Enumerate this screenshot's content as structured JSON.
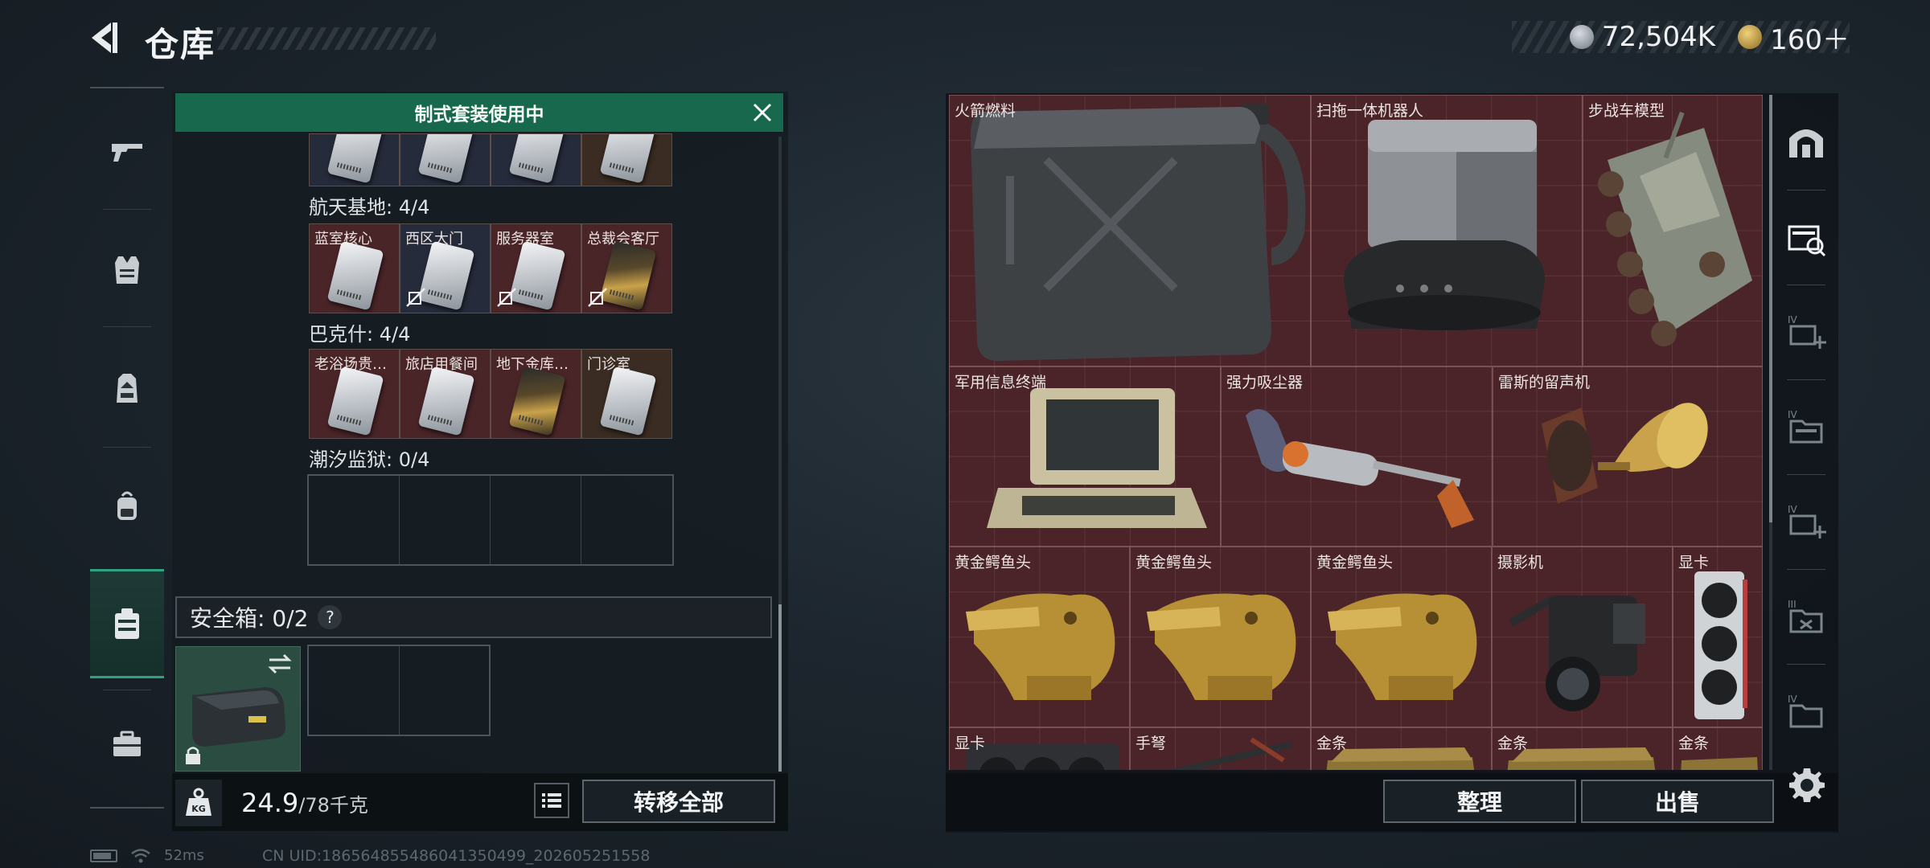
{
  "header": {
    "title": "仓库",
    "currency": [
      {
        "icon": "silver-coin-icon",
        "value": "72,504K"
      },
      {
        "icon": "gold-coin-icon",
        "value": "160＋"
      }
    ]
  },
  "left_rail": {
    "items": [
      {
        "name": "weapons",
        "icon": "gun-icon"
      },
      {
        "name": "armor",
        "icon": "armor-vest-icon"
      },
      {
        "name": "chest-rig",
        "icon": "chest-rig-icon"
      },
      {
        "name": "backpack",
        "icon": "backpack-icon"
      },
      {
        "name": "keycards",
        "icon": "keycard-case-icon",
        "active": true
      },
      {
        "name": "toolbox",
        "icon": "toolbox-icon"
      }
    ]
  },
  "suit": {
    "banner": "制式套装使用中"
  },
  "key_groups": [
    {
      "title": "航天基地: 4/4",
      "cards": [
        {
          "label": "蓝室核心",
          "style": "silver",
          "bg": "red",
          "unlinked": false
        },
        {
          "label": "西区大门",
          "style": "silver",
          "bg": "dark",
          "unlinked": true
        },
        {
          "label": "服务器室",
          "style": "silver",
          "bg": "red",
          "unlinked": true
        },
        {
          "label": "总裁会客厅",
          "style": "gold",
          "bg": "red",
          "unlinked": true
        }
      ]
    },
    {
      "title": "巴克什: 4/4",
      "cards": [
        {
          "label": "老浴场贵…",
          "style": "silver",
          "bg": "red",
          "unlinked": false
        },
        {
          "label": "旅店用餐间",
          "style": "silver",
          "bg": "red",
          "unlinked": false
        },
        {
          "label": "地下金库…",
          "style": "gold",
          "bg": "red",
          "unlinked": false
        },
        {
          "label": "门诊室",
          "style": "silver",
          "bg": "brown",
          "unlinked": false
        }
      ]
    },
    {
      "title": "潮汐监狱: 0/4",
      "cards": []
    }
  ],
  "safe_box": {
    "label": "安全箱: 0/2",
    "help": "?"
  },
  "weight": {
    "current": "24.9",
    "max": "/78千克",
    "badge": "KG"
  },
  "buttons": {
    "transfer_all": "转移全部",
    "sort": "整理",
    "sell": "出售"
  },
  "status": {
    "ping": "52ms",
    "uid": "CN UID:186564855486041350499_202605251558"
  },
  "stash": {
    "items": [
      {
        "label": "火箭燃料",
        "art": "fuel-can"
      },
      {
        "label": "扫拖一体机器人",
        "art": "robot-vacuum"
      },
      {
        "label": "步战车模型",
        "art": "ifv-model"
      },
      {
        "label": "军用信息终端",
        "art": "terminal"
      },
      {
        "label": "强力吸尘器",
        "art": "vacuum"
      },
      {
        "label": "雷斯的留声机",
        "art": "gramophone"
      },
      {
        "label": "黄金鳄鱼头",
        "art": "croc-head"
      },
      {
        "label": "黄金鳄鱼头",
        "art": "croc-head"
      },
      {
        "label": "黄金鳄鱼头",
        "art": "croc-head"
      },
      {
        "label": "摄影机",
        "art": "camera"
      },
      {
        "label": "显卡",
        "art": "gpu"
      },
      {
        "label": "显卡",
        "art": "gpu-flat"
      },
      {
        "label": "手弩",
        "art": "crossbow"
      },
      {
        "label": "金条",
        "art": "gold-bar"
      },
      {
        "label": "金条",
        "art": "gold-bar"
      },
      {
        "label": "金条",
        "art": "gold-bar"
      }
    ]
  },
  "right_rail": {
    "items": [
      {
        "name": "stash-home",
        "icon": "stash-arch-icon"
      },
      {
        "name": "stash-page-1",
        "icon": "stash-cases-icon",
        "active": true
      },
      {
        "name": "stash-page-2",
        "icon": "stash-add-icon",
        "tier": "IV"
      },
      {
        "name": "stash-page-3",
        "icon": "stash-folder-icon",
        "tier": "IV"
      },
      {
        "name": "stash-page-4",
        "icon": "stash-add-icon",
        "tier": "IV"
      },
      {
        "name": "stash-page-5",
        "icon": "stash-folder-icon",
        "tier": "III"
      },
      {
        "name": "stash-page-6",
        "icon": "stash-folder-icon",
        "tier": "IV"
      }
    ],
    "settings_icon": "gear-icon"
  },
  "colors": {
    "accent_green": "#17684c",
    "stash_red": "#4a2428",
    "panel": "#141b21"
  }
}
